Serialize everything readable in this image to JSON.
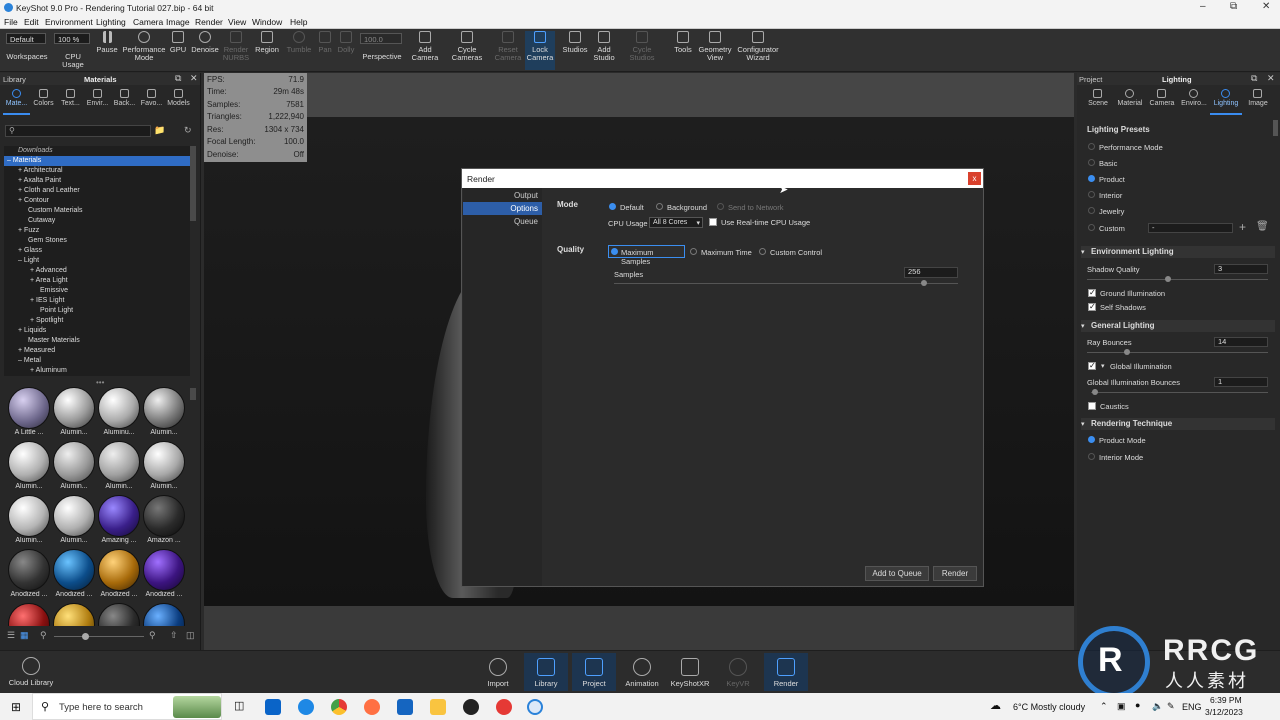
{
  "window": {
    "title": "KeyShot 9.0 Pro - Rendering Tutorial 027.bip - 64 bit"
  },
  "menu": [
    "File",
    "Edit",
    "Environment",
    "Lighting",
    "Camera",
    "Image",
    "Render",
    "View",
    "Window",
    "Help"
  ],
  "toolbar": {
    "workspace_value": "Default",
    "zoom_value": "100 %",
    "fov_value": "100.0",
    "items": [
      "Workspaces",
      "CPU Usage",
      "Pause",
      "Performance Mode",
      "GPU",
      "Denoise",
      "Render NURBS",
      "Region",
      "Tumble",
      "Pan",
      "Dolly",
      "Perspective",
      "Add Camera",
      "Cycle Cameras",
      "Reset Camera",
      "Lock Camera",
      "Studios",
      "Add Studio",
      "Cycle Studios",
      "Tools",
      "Geometry View",
      "Configurator Wizard"
    ]
  },
  "library": {
    "title": "Library",
    "panel_title": "Materials",
    "tabs": [
      "Mate...",
      "Colors",
      "Text...",
      "Envir...",
      "Back...",
      "Favo...",
      "Models"
    ],
    "tree": [
      "Downloads",
      "Materials",
      "Architectural",
      "Axalta Paint",
      "Cloth and Leather",
      "Contour",
      "Custom Materials",
      "Cutaway",
      "Fuzz",
      "Gem Stones",
      "Glass",
      "Light",
      "Advanced",
      "Area Light",
      "Emissive",
      "IES Light",
      "Point Light",
      "Spotlight",
      "Liquids",
      "Master Materials",
      "Measured",
      "Metal",
      "Aluminum"
    ],
    "thumbs": [
      "A Little ...",
      "Alumin...",
      "Aluminu...",
      "Alumin...",
      "Alumin...",
      "Alumin...",
      "Alumin...",
      "Alumin...",
      "Alumin...",
      "Alumin...",
      "Amazing ...",
      "Amazon ...",
      "Anodized ...",
      "Anodized ...",
      "Anodized ...",
      "Anodized ...",
      "",
      "",
      "",
      ""
    ],
    "cloud": "Cloud Library"
  },
  "hud": [
    {
      "k": "FPS:",
      "v": "71.9"
    },
    {
      "k": "Time:",
      "v": "29m 48s"
    },
    {
      "k": "Samples:",
      "v": "7581"
    },
    {
      "k": "Triangles:",
      "v": "1,222,940"
    },
    {
      "k": "Res:",
      "v": "1304 x 734"
    },
    {
      "k": "Focal Length:",
      "v": "100.0"
    },
    {
      "k": "Denoise:",
      "v": "Off"
    }
  ],
  "render_dialog": {
    "title": "Render",
    "close": "x",
    "nav": [
      "Output",
      "Options",
      "Queue"
    ],
    "mode_label": "Mode",
    "mode_options": [
      "Default",
      "Background",
      "Send to Network"
    ],
    "cpu_label": "CPU Usage",
    "cpu_value": "All 8 Cores",
    "realtime_cpu": "Use Real-time CPU Usage",
    "quality_label": "Quality",
    "quality_options": [
      "Maximum Samples",
      "Maximum Time",
      "Custom Control"
    ],
    "samples_label": "Samples",
    "samples_value": "256",
    "samples_fraction": 0.9,
    "add_queue": "Add to Queue",
    "render": "Render"
  },
  "project": {
    "title": "Project",
    "panel_title": "Lighting",
    "tabs": [
      "Scene",
      "Material",
      "Camera",
      "Enviro...",
      "Lighting",
      "Image"
    ],
    "presets_title": "Lighting Presets",
    "presets": [
      "Performance Mode",
      "Basic",
      "Product",
      "Interior",
      "Jewelry",
      "Custom"
    ],
    "custom_value": "-",
    "env_title": "Environment Lighting",
    "shadow_quality_label": "Shadow Quality",
    "shadow_quality_value": "3",
    "shadow_quality_fraction": 0.45,
    "ground_illum": "Ground Illumination",
    "self_shadows": "Self Shadows",
    "general_title": "General Lighting",
    "ray_bounces_label": "Ray Bounces",
    "ray_bounces_value": "14",
    "ray_bounces_fraction": 0.22,
    "global_illum": "Global Illumination",
    "gi_bounces_label": "Global Illumination Bounces",
    "gi_bounces_value": "1",
    "gi_bounces_fraction": 0.02,
    "caustics": "Caustics",
    "technique_title": "Rendering Technique",
    "techniques": [
      "Product Mode",
      "Interior Mode"
    ]
  },
  "bottom": [
    "Import",
    "Library",
    "Project",
    "Animation",
    "KeyShotXR",
    "KeyVR",
    "Render"
  ],
  "taskbar": {
    "search": "Type here to search",
    "weather": "6°C  Mostly cloudy",
    "lang": "ENG",
    "time": "6:39 PM",
    "date": "3/12/2023"
  },
  "watermark": {
    "brand": "RRCG",
    "sub": "人人素材"
  }
}
